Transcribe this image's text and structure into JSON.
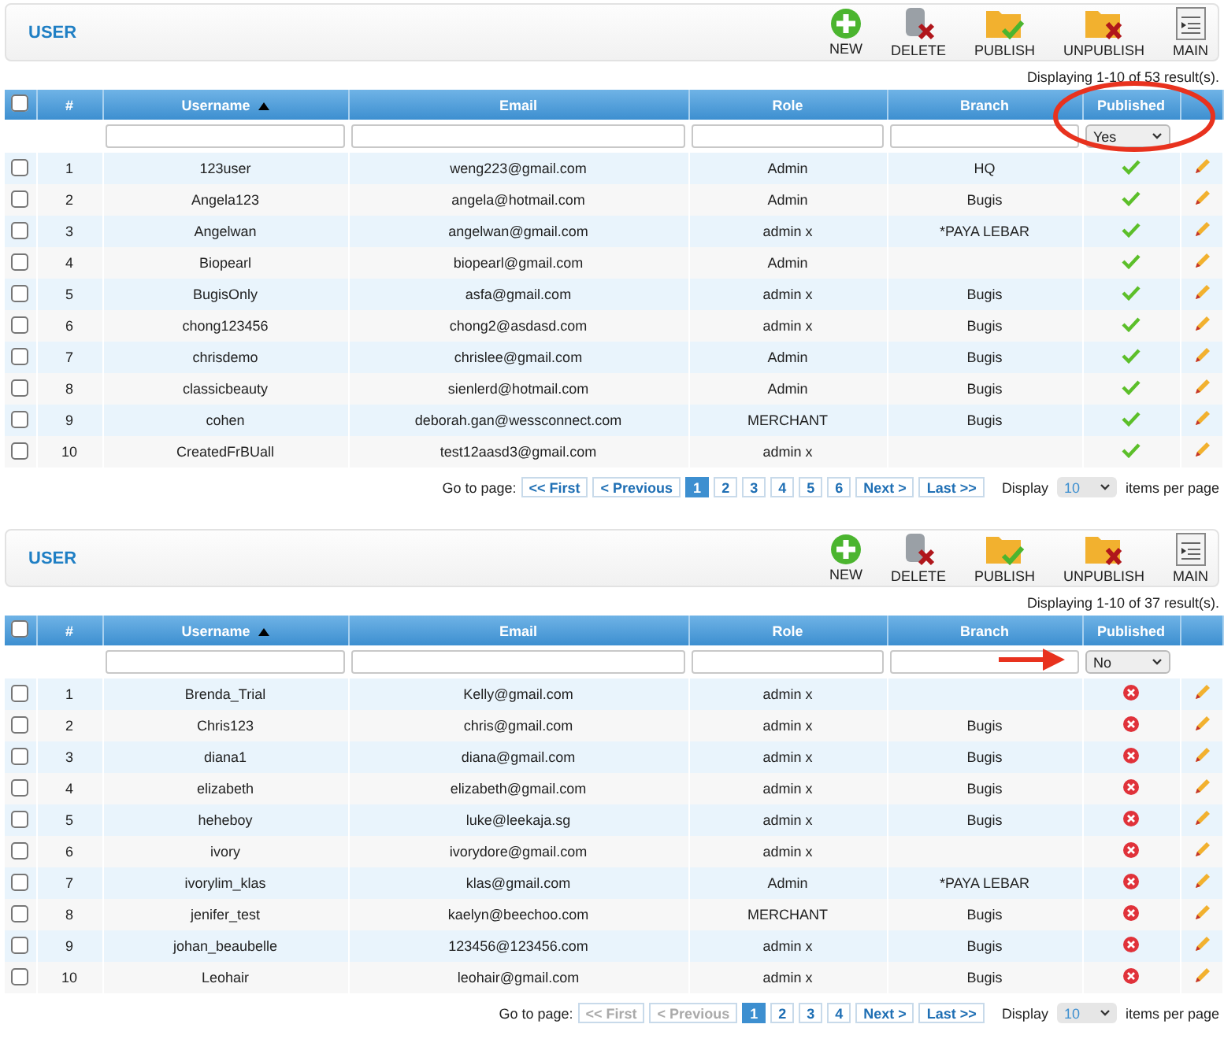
{
  "panels": [
    {
      "title": "USER",
      "toolbar": [
        {
          "kind": "new",
          "label": "NEW"
        },
        {
          "kind": "delete",
          "label": "DELETE"
        },
        {
          "kind": "publish",
          "label": "PUBLISH"
        },
        {
          "kind": "unpublish",
          "label": "UNPUBLISH"
        },
        {
          "kind": "main",
          "label": "MAIN"
        }
      ],
      "results": "Displaying 1-10 of 53 result(s).",
      "select_all_checked": false,
      "columns": [
        "#",
        "Username",
        "Email",
        "Role",
        "Branch",
        "Published"
      ],
      "filter_published": "Yes",
      "annotation": {
        "kind": "circle"
      },
      "rows": [
        {
          "checked": false,
          "no": "1",
          "username": "123user",
          "email": "weng223@gmail.com",
          "role": "Admin",
          "branch": "HQ",
          "published": true
        },
        {
          "checked": false,
          "no": "2",
          "username": "Angela123",
          "email": "angela@hotmail.com",
          "role": "Admin",
          "branch": "Bugis",
          "published": true
        },
        {
          "checked": false,
          "no": "3",
          "username": "Angelwan",
          "email": "angelwan@gmail.com",
          "role": "admin x",
          "branch": "*PAYA LEBAR",
          "published": true
        },
        {
          "checked": false,
          "no": "4",
          "username": "Biopearl",
          "email": "biopearl@gmail.com",
          "role": "Admin",
          "branch": "",
          "published": true
        },
        {
          "checked": false,
          "no": "5",
          "username": "BugisOnly",
          "email": "asfa@gmail.com",
          "role": "admin x",
          "branch": "Bugis",
          "published": true
        },
        {
          "checked": false,
          "no": "6",
          "username": "chong123456",
          "email": "chong2@asdasd.com",
          "role": "admin x",
          "branch": "Bugis",
          "published": true
        },
        {
          "checked": false,
          "no": "7",
          "username": "chrisdemo",
          "email": "chrislee@gmail.com",
          "role": "Admin",
          "branch": "Bugis",
          "published": true
        },
        {
          "checked": false,
          "no": "8",
          "username": "classicbeauty",
          "email": "sienlerd@hotmail.com",
          "role": "Admin",
          "branch": "Bugis",
          "published": true
        },
        {
          "checked": false,
          "no": "9",
          "username": "cohen",
          "email": "deborah.gan@wessconnect.com",
          "role": "MERCHANT",
          "branch": "Bugis",
          "published": true
        },
        {
          "checked": false,
          "no": "10",
          "username": "CreatedFrBUall",
          "email": "test12aasd3@gmail.com",
          "role": "admin x",
          "branch": "",
          "published": true
        }
      ],
      "pager": {
        "goto": "Go to page:",
        "first": {
          "label": "<< First",
          "disabled": false
        },
        "previous": {
          "label": "< Previous",
          "disabled": false
        },
        "pages": [
          {
            "label": "1",
            "selected": true
          },
          {
            "label": "2",
            "selected": false
          },
          {
            "label": "3",
            "selected": false
          },
          {
            "label": "4",
            "selected": false
          },
          {
            "label": "5",
            "selected": false
          },
          {
            "label": "6",
            "selected": false
          }
        ],
        "next": "Next >",
        "last": "Last >>",
        "display": "Display",
        "per_page": "10",
        "items_per_page": "items per page"
      }
    },
    {
      "title": "USER",
      "toolbar": [
        {
          "kind": "new",
          "label": "NEW"
        },
        {
          "kind": "delete",
          "label": "DELETE"
        },
        {
          "kind": "publish",
          "label": "PUBLISH"
        },
        {
          "kind": "unpublish",
          "label": "UNPUBLISH"
        },
        {
          "kind": "main",
          "label": "MAIN"
        }
      ],
      "results": "Displaying 1-10 of 37 result(s).",
      "select_all_checked": false,
      "columns": [
        "#",
        "Username",
        "Email",
        "Role",
        "Branch",
        "Published"
      ],
      "filter_published": "No",
      "annotation": {
        "kind": "arrow"
      },
      "rows": [
        {
          "checked": false,
          "no": "1",
          "username": "Brenda_Trial",
          "email": "Kelly@gmail.com",
          "role": "admin x",
          "branch": "",
          "published": false
        },
        {
          "checked": false,
          "no": "2",
          "username": "Chris123",
          "email": "chris@gmail.com",
          "role": "admin x",
          "branch": "Bugis",
          "published": false
        },
        {
          "checked": false,
          "no": "3",
          "username": "diana1",
          "email": "diana@gmail.com",
          "role": "admin x",
          "branch": "Bugis",
          "published": false
        },
        {
          "checked": false,
          "no": "4",
          "username": "elizabeth",
          "email": "elizabeth@gmail.com",
          "role": "admin x",
          "branch": "Bugis",
          "published": false
        },
        {
          "checked": false,
          "no": "5",
          "username": "heheboy",
          "email": "luke@leekaja.sg",
          "role": "admin x",
          "branch": "Bugis",
          "published": false
        },
        {
          "checked": false,
          "no": "6",
          "username": "ivory",
          "email": "ivorydore@gmail.com",
          "role": "admin x",
          "branch": "",
          "published": false
        },
        {
          "checked": false,
          "no": "7",
          "username": "ivorylim_klas",
          "email": "klas@gmail.com",
          "role": "Admin",
          "branch": "*PAYA LEBAR",
          "published": false
        },
        {
          "checked": false,
          "no": "8",
          "username": "jenifer_test",
          "email": "kaelyn@beechoo.com",
          "role": "MERCHANT",
          "branch": "Bugis",
          "published": false
        },
        {
          "checked": false,
          "no": "9",
          "username": "johan_beaubelle",
          "email": "123456@123456.com",
          "role": "admin x",
          "branch": "Bugis",
          "published": false
        },
        {
          "checked": false,
          "no": "10",
          "username": "Leohair",
          "email": "leohair@gmail.com",
          "role": "admin x",
          "branch": "Bugis",
          "published": false
        }
      ],
      "pager": {
        "goto": "Go to page:",
        "first": {
          "label": "<< First",
          "disabled": true
        },
        "previous": {
          "label": "< Previous",
          "disabled": true
        },
        "pages": [
          {
            "label": "1",
            "selected": true
          },
          {
            "label": "2",
            "selected": false
          },
          {
            "label": "3",
            "selected": false
          },
          {
            "label": "4",
            "selected": false
          }
        ],
        "next": "Next >",
        "last": "Last >>",
        "display": "Display",
        "per_page": "10",
        "items_per_page": "items per page"
      }
    }
  ]
}
